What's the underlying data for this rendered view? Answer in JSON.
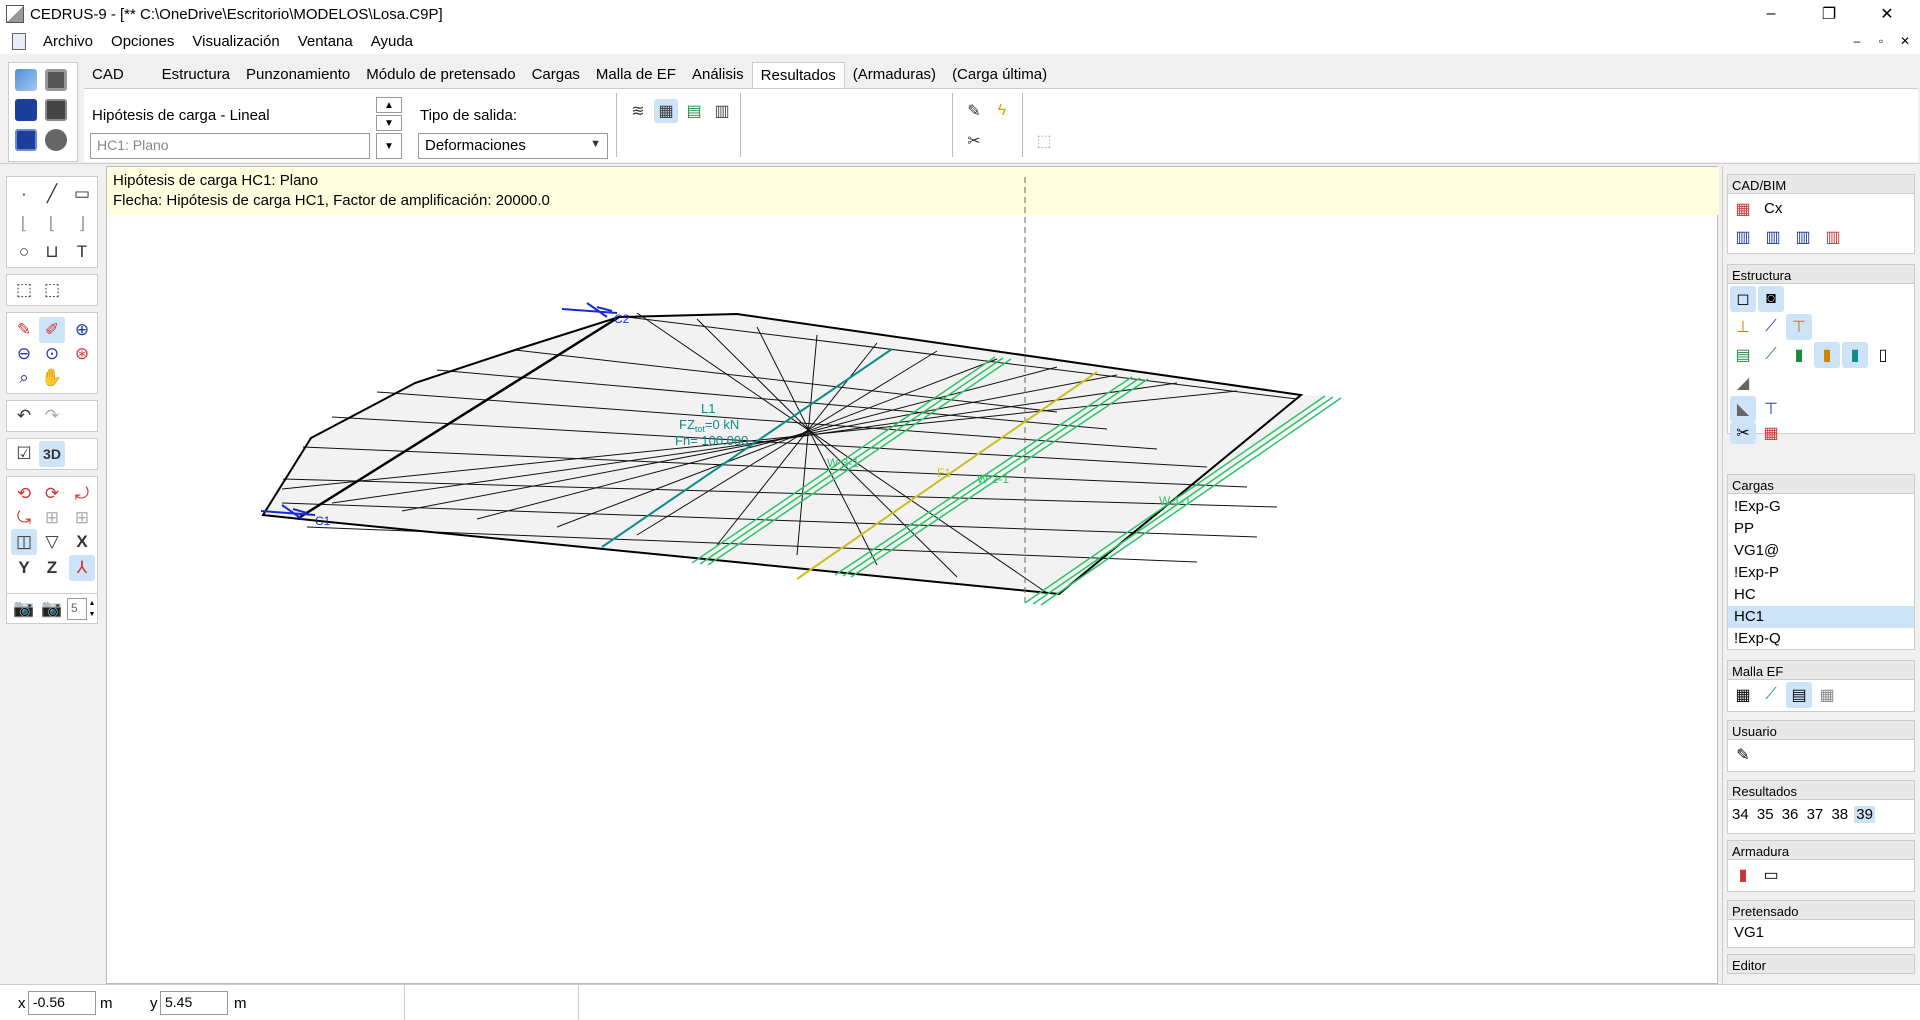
{
  "window": {
    "title": "CEDRUS-9 - [** C:\\OneDrive\\Escritorio\\MODELOS\\Losa.C9P]",
    "minimize": "–",
    "restore": "❐",
    "close": "✕"
  },
  "menu": {
    "items": [
      "Archivo",
      "Opciones",
      "Visualización",
      "Ventana",
      "Ayuda"
    ],
    "mdi_min": "–",
    "mdi_restore": "▫",
    "mdi_close": "✕"
  },
  "ribbon": {
    "tabs": [
      "CAD",
      "Estructura",
      "Punzonamiento",
      "Módulo de pretensado",
      "Cargas",
      "Malla de EF",
      "Análisis",
      "Resultados",
      "(Armaduras)",
      "(Carga última)"
    ],
    "active_tab": "Resultados",
    "load_label": "Hipótesis de carga - Lineal",
    "load_value": "HC1:    Plano",
    "output_label": "Tipo de salida:",
    "output_value": "Deformaciones"
  },
  "canvas": {
    "info_line1": "Hipótesis de carga HC1: Plano",
    "info_line2": "Flecha: Hipótesis de carga HC1, Factor de amplificación: 20000.0",
    "labels": {
      "c1": "C1",
      "c2": "C2",
      "l1": "L1",
      "fz_a": "FZ",
      "fz_sub": "tot",
      "fz_b": "=0 kN",
      "fn": "Fn= 100.000",
      "w31": "W 3-1",
      "f1": "F1",
      "w21": "W 2-1",
      "w11": "W 1-1"
    }
  },
  "left_toolbar": {
    "text_tool": "T",
    "view_3d": "3D",
    "axis_x": "X",
    "axis_y": "Y",
    "axis_z": "Z",
    "spin_value": "5"
  },
  "right_panel": {
    "cad_bim": {
      "title": "CAD/BIM",
      "cx_label": "Cx"
    },
    "estructura": {
      "title": "Estructura"
    },
    "cargas": {
      "title": "Cargas",
      "items": [
        "!Exp-G",
        "PP",
        "VG1@",
        "!Exp-P",
        "HC",
        "HC1",
        "!Exp-Q"
      ],
      "selected": "HC1"
    },
    "malla": {
      "title": "Malla EF"
    },
    "usuario": {
      "title": "Usuario"
    },
    "resultados": {
      "title": "Resultados",
      "items": [
        "34",
        "35",
        "36",
        "37",
        "38",
        "39"
      ],
      "selected": "39"
    },
    "armadura": {
      "title": "Armadura"
    },
    "pretensado": {
      "title": "Pretensado",
      "value": "VG1"
    },
    "editor": {
      "title": "Editor"
    }
  },
  "status": {
    "x_label": "x",
    "x_value": "-0.56",
    "x_unit": "m",
    "y_label": "y",
    "y_value": "5.45",
    "y_unit": "m"
  },
  "colors": {
    "support_blue": "#1a2bd6",
    "line_teal": "#0e8a8a",
    "line_green": "#2bc46a",
    "line_yellow": "#c8c020",
    "selection": "#cde3f7",
    "info_bg": "#ffffe0"
  }
}
